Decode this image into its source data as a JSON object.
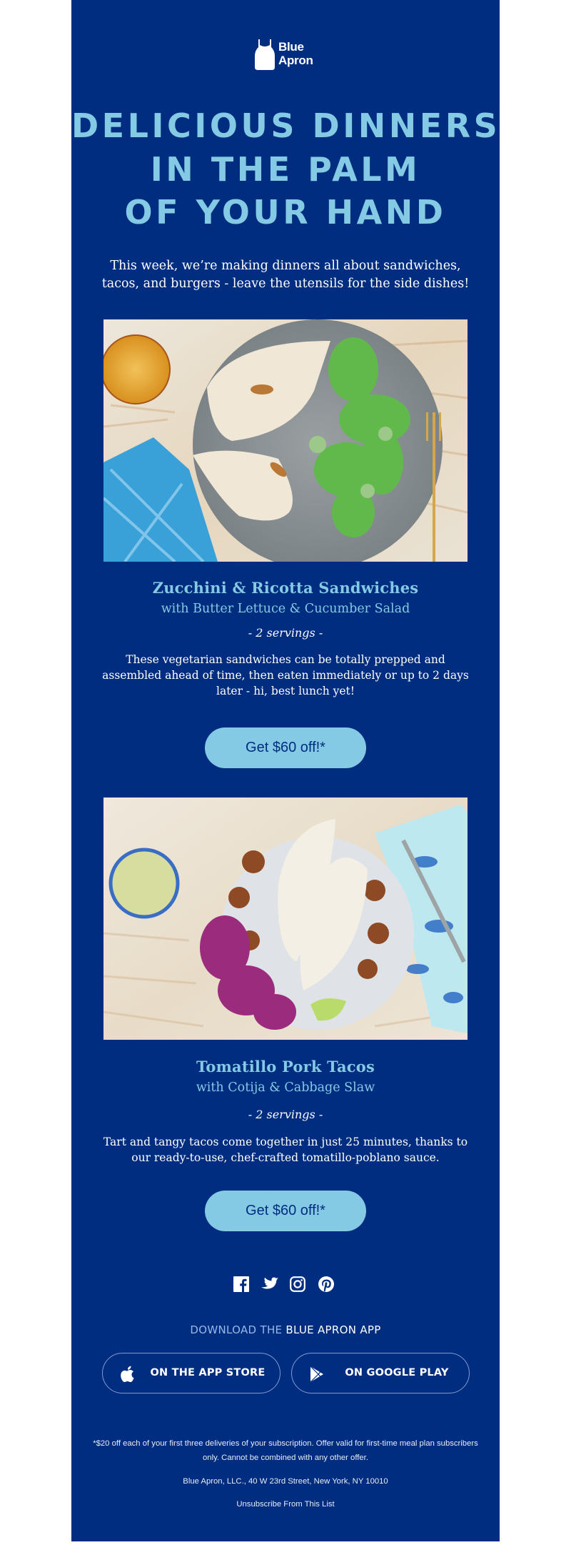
{
  "brand": {
    "name_line1": "Blue",
    "name_line2": "Apron",
    "logo_icon": "apron-icon"
  },
  "colors": {
    "background": "#002d80",
    "accent_light_blue": "#84cae4",
    "text": "#ffffff",
    "page": "#ffffff"
  },
  "hero": {
    "headline_lines": [
      "DELICIOUS DINNERS",
      "IN THE PALM",
      "OF YOUR HAND"
    ],
    "intro": "This week, we’re making dinners all about sandwiches, tacos, and burgers - leave the utensils for the side dishes!"
  },
  "recipes": [
    {
      "image_alt": "Zucchini & Ricotta Sandwiches with butter lettuce and cucumber salad on a speckled grey plate",
      "title": "Zucchini & Ricotta Sandwiches",
      "subtitle": "with Butter Lettuce & Cucumber Salad",
      "servings": "- 2 servings -",
      "description": "These vegetarian sandwiches can be totally prepped and assembled ahead of time, then eaten immediately or up to 2 days later - hi, best lunch yet!",
      "cta_label": "Get $60 off!*"
    },
    {
      "image_alt": "Tomatillo Pork Tacos with cotija and red cabbage slaw on a speckled plate",
      "title": "Tomatillo Pork Tacos",
      "subtitle": "with Cotija & Cabbage Slaw",
      "servings": "- 2 servings -",
      "description": "Tart and tangy tacos come together in just 25 minutes, thanks to our ready-to-use, chef-crafted tomatillo-poblano sauce.",
      "cta_label": "Get $60 off!*"
    }
  ],
  "social": {
    "icons": [
      "facebook-icon",
      "twitter-icon",
      "instagram-icon",
      "pinterest-icon"
    ]
  },
  "app_download": {
    "prefix": "DOWNLOAD THE ",
    "app_name": "BLUE APRON APP",
    "app_store_label": "ON THE APP STORE",
    "google_play_label": "ON GOOGLE PLAY"
  },
  "footer": {
    "disclaimer": "*$20 off each of your first three deliveries of your subscription. Offer valid for first-time meal plan subscribers only. Cannot be combined with any other offer.",
    "address": "Blue Apron, LLC., 40 W 23rd Street, New York, NY 10010",
    "unsubscribe": "Unsubscribe From This List"
  }
}
